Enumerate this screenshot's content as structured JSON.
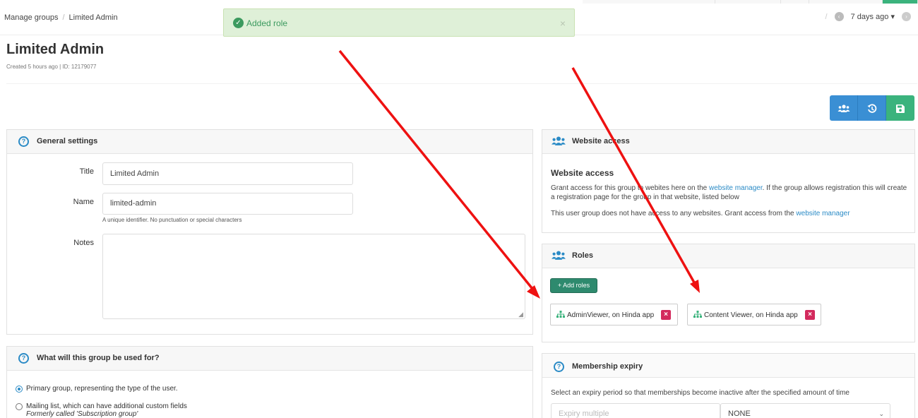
{
  "breadcrumb": {
    "parent": "Manage groups",
    "current": "Limited Admin"
  },
  "toast": {
    "message": "Added role",
    "close": "×"
  },
  "history": {
    "label": "7 days ago",
    "caret": "▾"
  },
  "page": {
    "title": "Limited Admin",
    "meta": "Created 5 hours ago | ID: 12179077"
  },
  "general": {
    "heading": "General settings",
    "title_label": "Title",
    "title_value": "Limited Admin",
    "name_label": "Name",
    "name_value": "limited-admin",
    "name_hint": "A unique identifier. No punctuation or special characters",
    "notes_label": "Notes"
  },
  "usage": {
    "heading": "What will this group be used for?",
    "options": [
      {
        "label": "Primary group, representing the type of the user.",
        "selected": true
      },
      {
        "label": "Mailing list, which can have additional custom fields",
        "sub": "Formerly called 'Subscription group'",
        "selected": false
      }
    ]
  },
  "website_access": {
    "heading": "Website access",
    "subheading": "Website access",
    "p1_before": "Grant access for this group to webites here on the ",
    "p1_link": "website manager",
    "p1_after": ". If the group allows registration this will create a registration page for the group in that website, listed below",
    "p2_before": "This user group does not have access to any websites. Grant access from the ",
    "p2_link": "website manager"
  },
  "roles": {
    "heading": "Roles",
    "add_label": "+ Add roles",
    "items": [
      {
        "label": "AdminViewer, on Hinda app"
      },
      {
        "label": "Content Viewer, on Hinda app"
      }
    ],
    "remove_glyph": "×"
  },
  "expiry": {
    "heading": "Membership expiry",
    "description": "Select an expiry period so that memberships become inactive after the specified amount of time",
    "multiple_placeholder": "Expiry multiple",
    "period_value": "NONE"
  },
  "colors": {
    "primary": "#3a8fd4",
    "success": "#3bb37d",
    "danger": "#d32a5d",
    "annotation": "#ee1111"
  },
  "icons": {
    "prev": "chevron-left-circle-icon",
    "next": "chevron-right-circle-icon",
    "users": "users-icon",
    "history": "history-icon",
    "save": "save-icon",
    "help": "question-circle-icon",
    "hierarchy": "sitemap-icon"
  }
}
